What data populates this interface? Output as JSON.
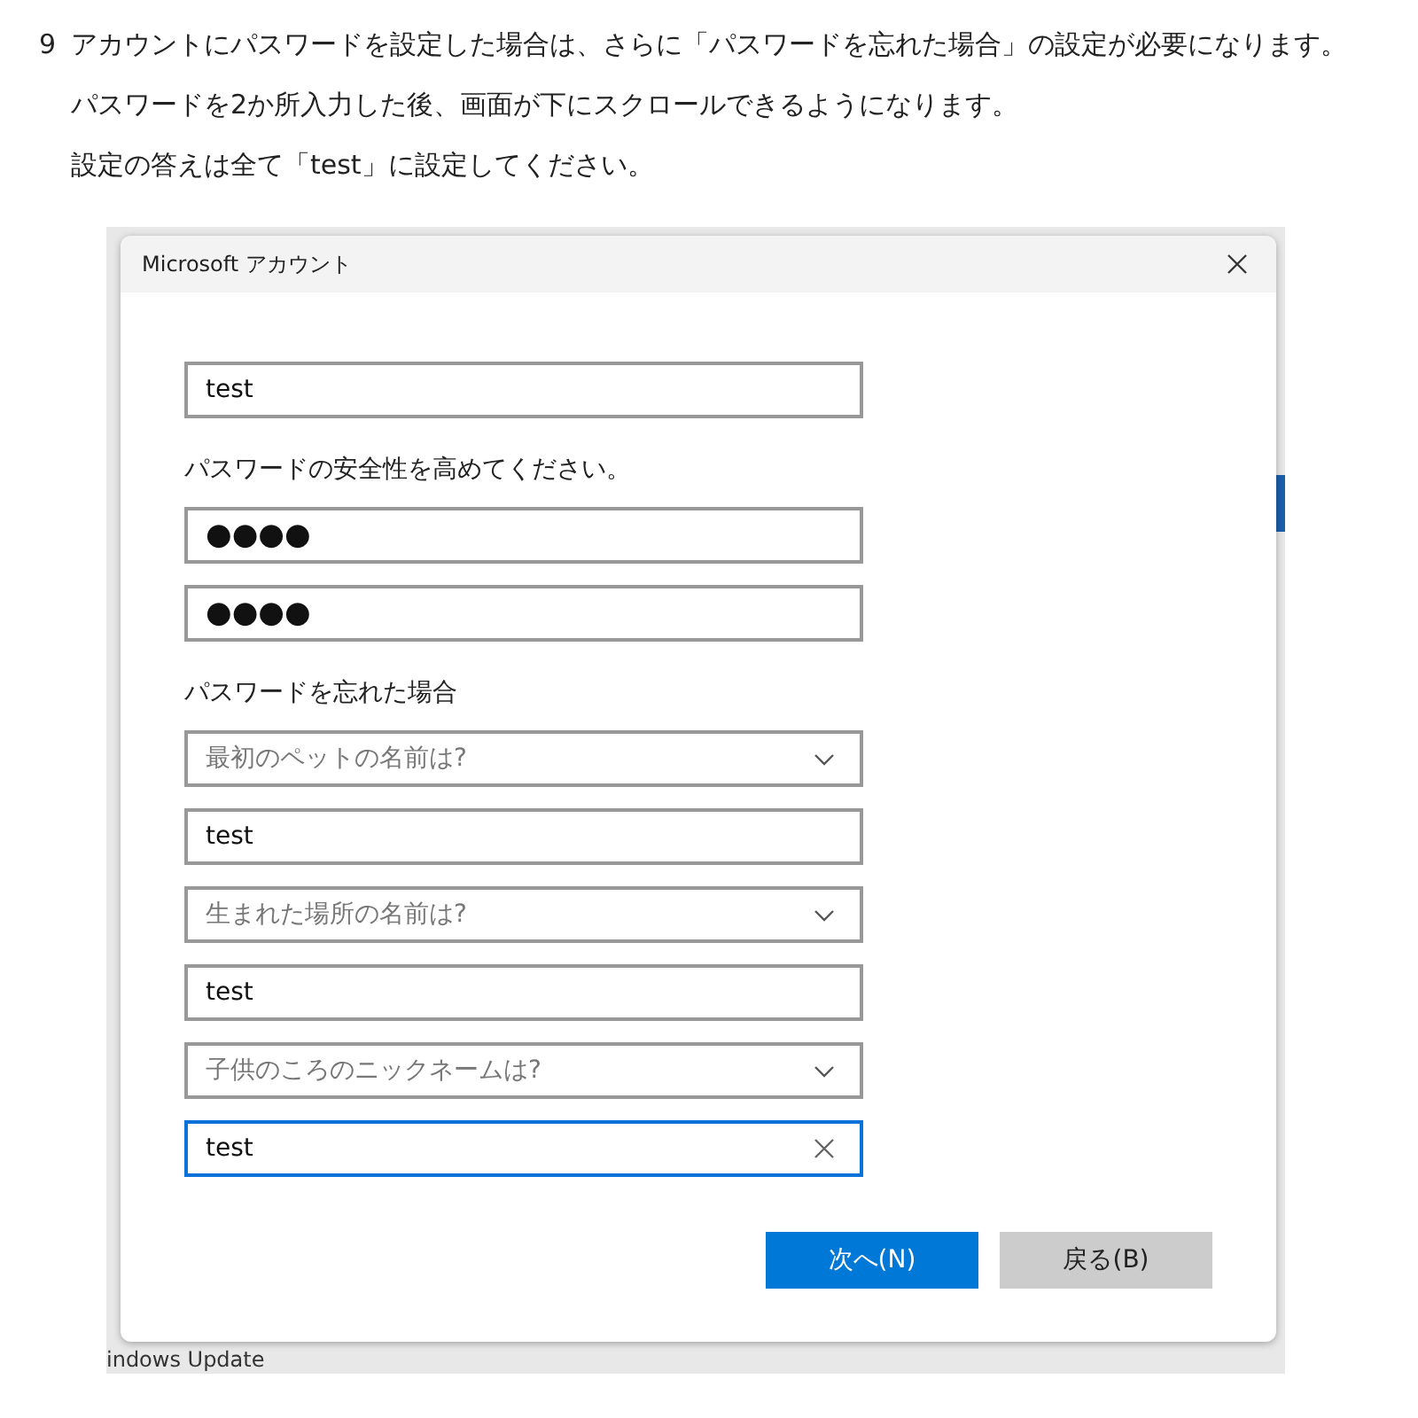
{
  "instructions": {
    "step_number": "9",
    "lines": [
      "アカウントにパスワードを設定した場合は、さらに「パスワードを忘れた場合」の設定が必要になります。",
      "パスワードを2か所入力した後、画面が下にスクロールできるようになります。",
      "設定の答えは全て「test」に設定してください。"
    ]
  },
  "background_window": {
    "footer_text": "indows Update"
  },
  "dialog": {
    "title": "Microsoft アカウント",
    "items": [
      {
        "kind": "text",
        "value": "test",
        "focused": false
      },
      {
        "kind": "label",
        "text": "パスワードの安全性を高めてください。"
      },
      {
        "kind": "password",
        "value": "●●●●",
        "focused": false
      },
      {
        "kind": "password",
        "value": "●●●●",
        "focused": false
      },
      {
        "kind": "label",
        "text": "パスワードを忘れた場合"
      },
      {
        "kind": "select",
        "placeholder": "最初のペットの名前は?"
      },
      {
        "kind": "text",
        "value": "test",
        "focused": false
      },
      {
        "kind": "select",
        "placeholder": "生まれた場所の名前は?"
      },
      {
        "kind": "text",
        "value": "test",
        "focused": false
      },
      {
        "kind": "select",
        "placeholder": "子供のころのニックネームは?"
      },
      {
        "kind": "text",
        "value": "test",
        "focused": true
      }
    ],
    "buttons": [
      {
        "label": "次へ(N)",
        "primary": true
      },
      {
        "label": "戻る(B)",
        "primary": false
      }
    ]
  }
}
